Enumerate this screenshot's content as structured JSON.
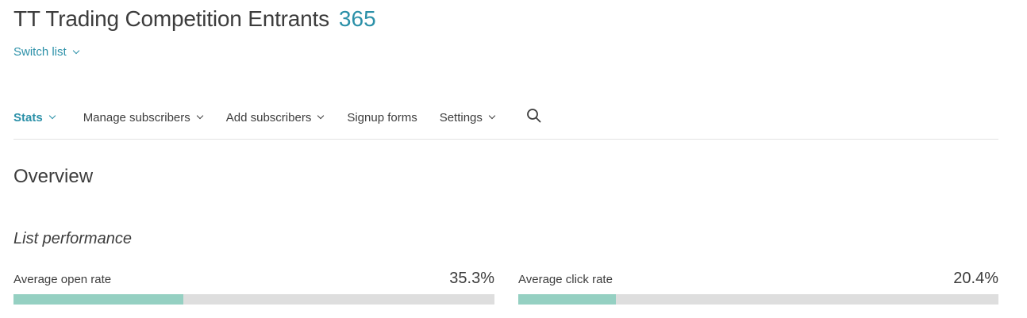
{
  "header": {
    "title": "TT Trading Competition Entrants",
    "count": "365",
    "switch_list_label": "Switch list"
  },
  "nav": {
    "tabs": [
      {
        "label": "Stats",
        "active": true,
        "has_dropdown": true
      },
      {
        "label": "Manage subscribers",
        "active": false,
        "has_dropdown": true
      },
      {
        "label": "Add subscribers",
        "active": false,
        "has_dropdown": true
      },
      {
        "label": "Signup forms",
        "active": false,
        "has_dropdown": false
      },
      {
        "label": "Settings",
        "active": false,
        "has_dropdown": true
      }
    ],
    "search_icon": "search-icon"
  },
  "overview": {
    "heading": "Overview",
    "performance_heading": "List performance",
    "metrics": [
      {
        "label": "Average open rate",
        "value": "35.3%",
        "fraction": 0.353
      },
      {
        "label": "Average click rate",
        "value": "20.4%",
        "fraction": 0.204
      }
    ]
  },
  "colors": {
    "accent": "#2b90a8",
    "text": "#3d3d3d",
    "bar_fill": "#95d0c2",
    "bar_track": "#dedede",
    "divider": "#e3e3e3"
  }
}
